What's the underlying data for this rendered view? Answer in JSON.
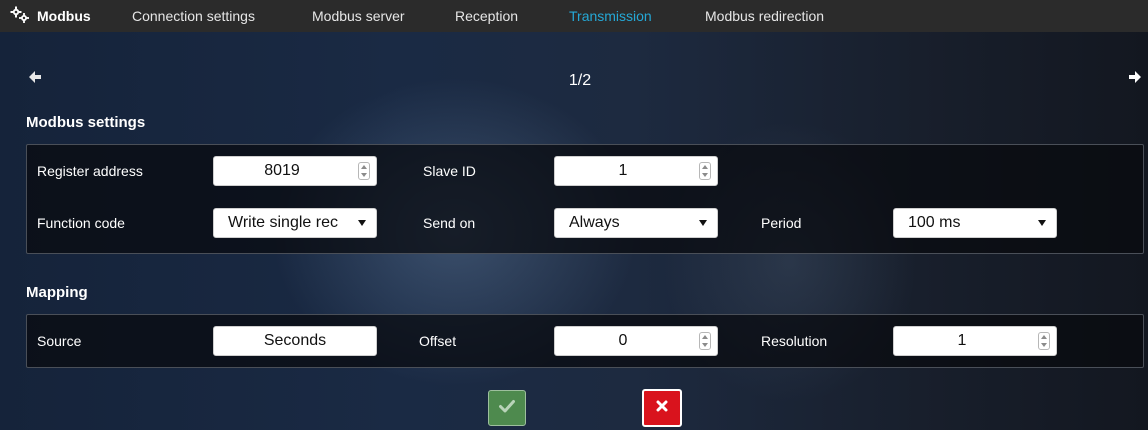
{
  "topbar": {
    "brand_label": "Modbus",
    "brand_icon": "gear-network-icon",
    "tabs": [
      {
        "label": "Connection settings"
      },
      {
        "label": "Modbus server"
      },
      {
        "label": "Reception"
      },
      {
        "label": "Transmission"
      },
      {
        "label": "Modbus redirection"
      }
    ],
    "active_tab": "Transmission"
  },
  "pager": {
    "label": "1/2",
    "prev_icon": "arrow-left-icon",
    "next_icon": "arrow-right-icon"
  },
  "modbus_settings": {
    "title": "Modbus settings",
    "register_address": {
      "label": "Register address",
      "value": "8019"
    },
    "slave_id": {
      "label": "Slave ID",
      "value": "1"
    },
    "function_code": {
      "label": "Function code",
      "value": "Write single rec"
    },
    "send_on": {
      "label": "Send on",
      "value": "Always"
    },
    "period": {
      "label": "Period",
      "value": "100 ms"
    }
  },
  "mapping": {
    "title": "Mapping",
    "source": {
      "label": "Source",
      "value": "Seconds"
    },
    "offset": {
      "label": "Offset",
      "value": "0"
    },
    "resolution": {
      "label": "Resolution",
      "value": "1"
    }
  },
  "actions": {
    "confirm_icon": "check-icon",
    "cancel_icon": "close-icon"
  },
  "colors": {
    "topbar_bg": "#2b2b2b",
    "active_tab": "#25a8d6",
    "confirm_button": "#4e8a4e",
    "cancel_button": "#d9131d"
  }
}
